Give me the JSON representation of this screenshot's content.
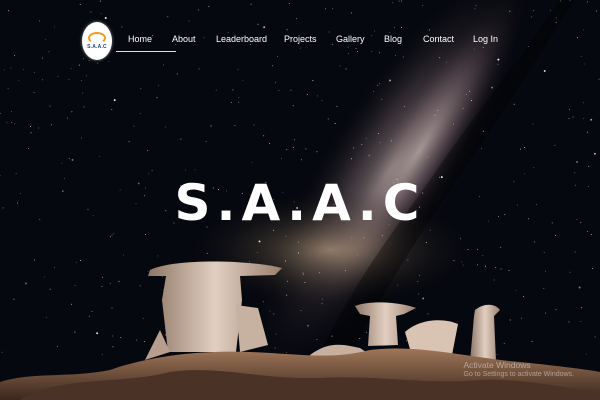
{
  "logo": {
    "text": "S.A.A.C"
  },
  "nav": {
    "items": [
      {
        "label": "Home",
        "active": true
      },
      {
        "label": "About"
      },
      {
        "label": "Leaderboard"
      },
      {
        "label": "Projects"
      },
      {
        "label": "Gallery"
      },
      {
        "label": "Blog"
      },
      {
        "label": "Contact"
      },
      {
        "label": "Log In"
      }
    ]
  },
  "hero": {
    "title": "S.A.A.C"
  },
  "watermark": {
    "title": "Activate Windows",
    "subtitle": "Go to Settings to activate Windows."
  },
  "colors": {
    "sky": "#06080f",
    "milkyway": "#b3a19a",
    "rock": "#c9b3a3",
    "ground": "#6b4a36"
  }
}
